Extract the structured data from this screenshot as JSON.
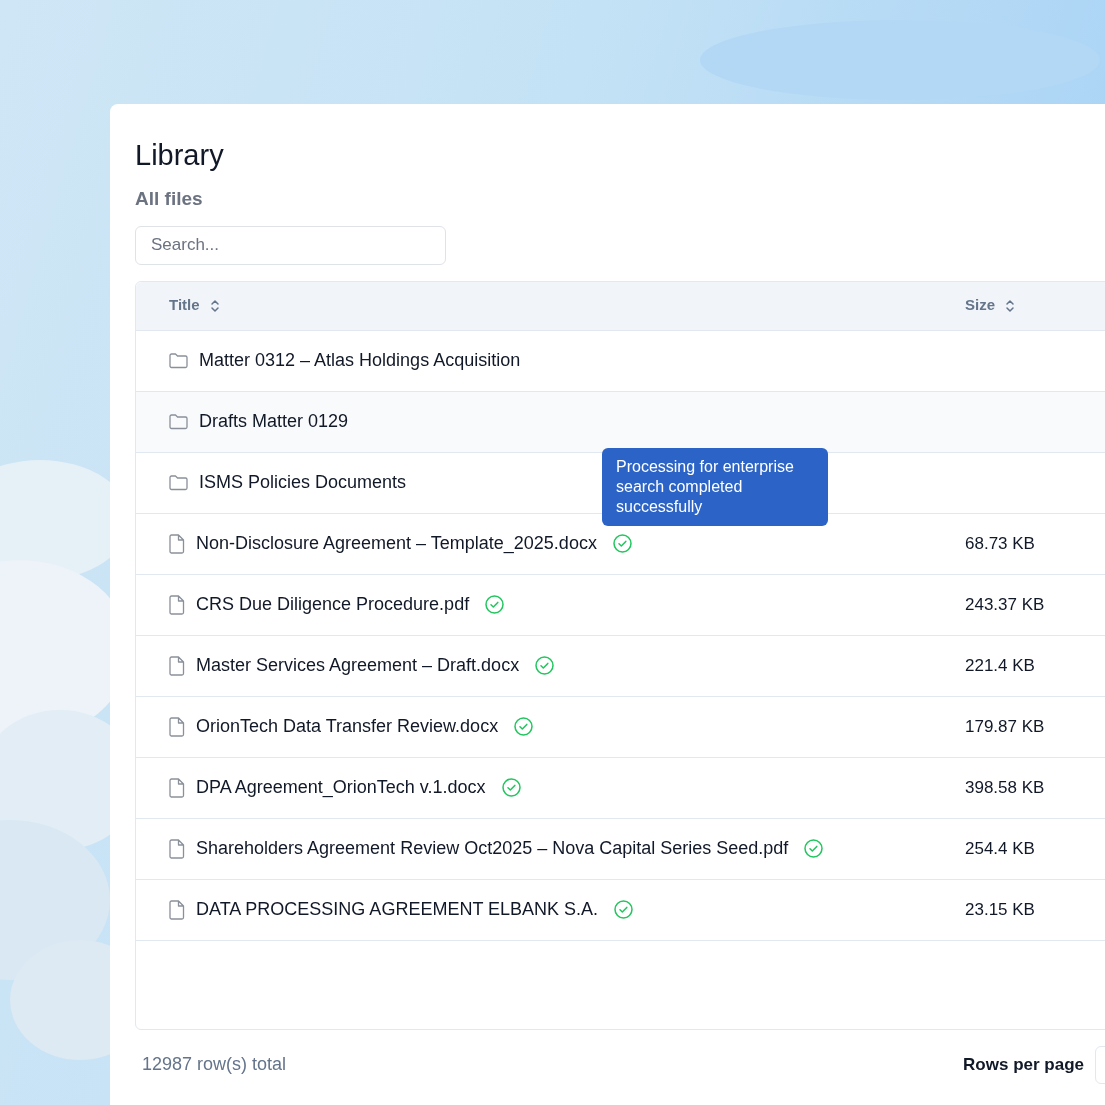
{
  "page": {
    "title": "Library",
    "subtitle": "All files"
  },
  "search": {
    "placeholder": "Search..."
  },
  "table": {
    "columns": [
      "Title",
      "Size"
    ],
    "rows": [
      {
        "kind": "folder",
        "title": "Matter 0312 – Atlas Holdings Acquisition",
        "highlighted": false,
        "processed": false
      },
      {
        "kind": "folder",
        "title": "Drafts Matter 0129",
        "highlighted": true,
        "processed": false
      },
      {
        "kind": "folder",
        "title": "ISMS Policies Documents",
        "highlighted": false,
        "processed": false
      },
      {
        "kind": "file",
        "title": "Non-Disclosure Agreement – Template_2025.docx",
        "size": "68.73 KB",
        "highlighted": false,
        "processed": true
      },
      {
        "kind": "file",
        "title": "CRS Due Diligence Procedure.pdf",
        "size": "243.37 KB",
        "highlighted": false,
        "processed": true
      },
      {
        "kind": "file",
        "title": "Master Services Agreement – Draft.docx",
        "size": "221.4 KB",
        "highlighted": false,
        "processed": true
      },
      {
        "kind": "file",
        "title": "OrionTech Data Transfer Review.docx",
        "size": "179.87 KB",
        "highlighted": false,
        "processed": true
      },
      {
        "kind": "file",
        "title": "DPA Agreement_OrionTech v.1.docx",
        "size": "398.58 KB",
        "highlighted": false,
        "processed": true
      },
      {
        "kind": "file",
        "title": "Shareholders Agreement Review Oct2025 – Nova Capital Series Seed.pdf",
        "size": "254.4 KB",
        "highlighted": false,
        "processed": true
      },
      {
        "kind": "file",
        "title": "DATA PROCESSING AGREEMENT ELBANK S.A.",
        "size": "23.15 KB",
        "highlighted": false,
        "processed": true
      }
    ]
  },
  "tooltip": {
    "text": "Processing for enterprise search completed successfully"
  },
  "footer": {
    "total": "12987 row(s) total",
    "rows_per_page_label": "Rows per page"
  }
}
